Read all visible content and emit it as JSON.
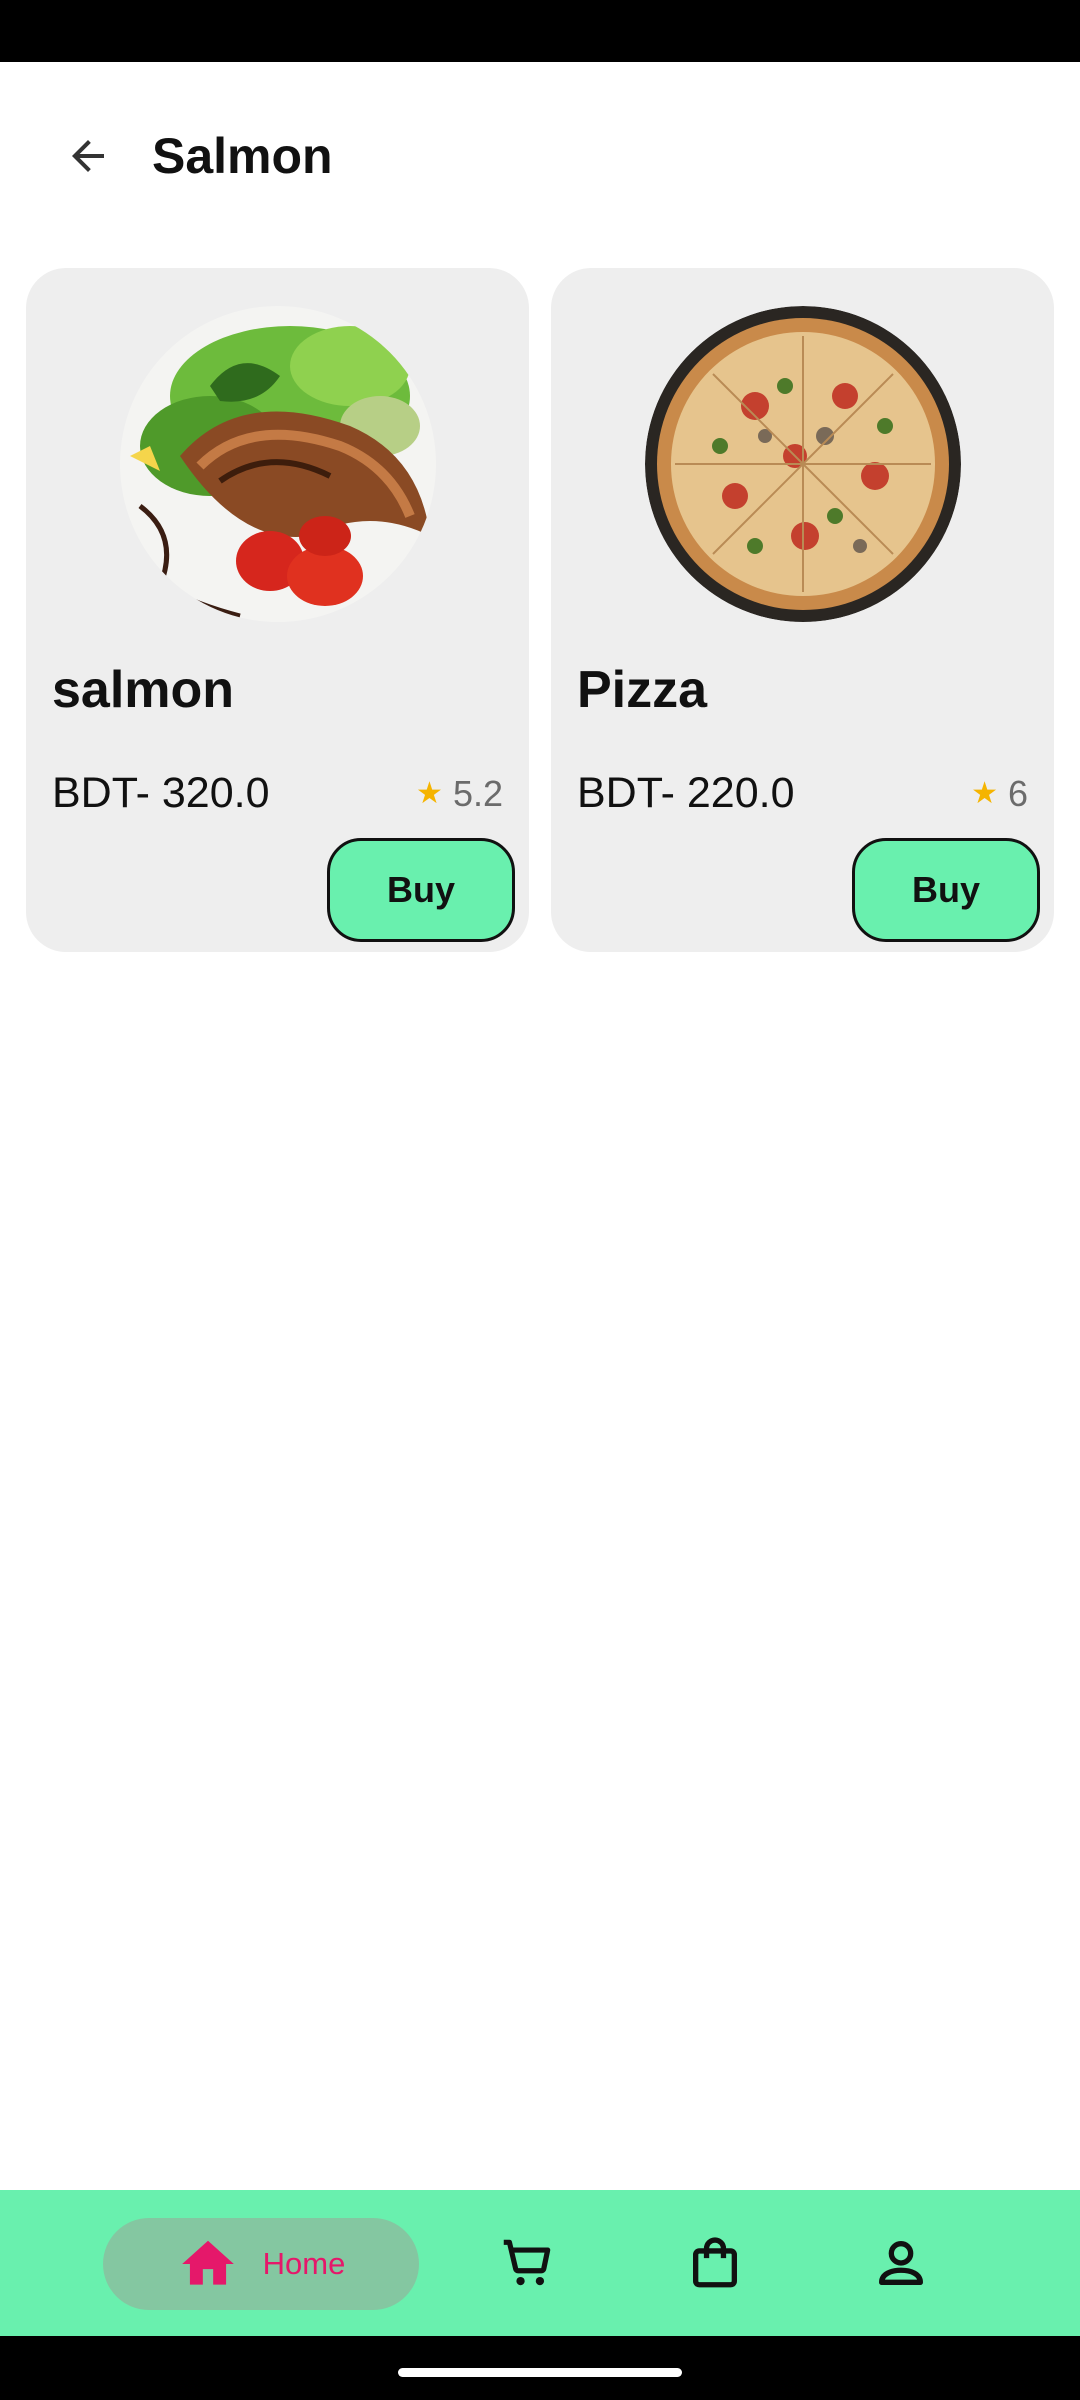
{
  "app_bar": {
    "title": "Salmon"
  },
  "products": [
    {
      "name": "salmon",
      "price": "BDT- 320.0",
      "rating": "5.2",
      "buy_label": "Buy"
    },
    {
      "name": "Pizza",
      "price": "BDT- 220.0",
      "rating": "6",
      "buy_label": "Buy"
    }
  ],
  "bottom_nav": {
    "home_label": "Home",
    "items": [
      "home-icon",
      "cart-icon",
      "shopping-bag-icon",
      "person-icon"
    ]
  },
  "colors": {
    "accent": "#69f0ae",
    "home_active": "#e5186a",
    "star": "#f5b400",
    "card_bg": "#eeeeee"
  }
}
